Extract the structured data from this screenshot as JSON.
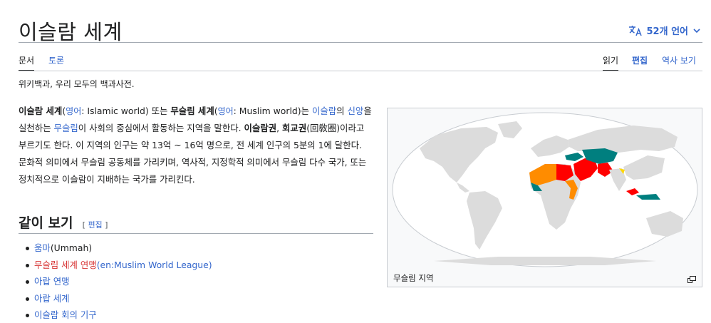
{
  "page": {
    "title": "이슬람 세계",
    "languages_label": "52개 언어"
  },
  "tabs": {
    "article": "문서",
    "talk": "토론",
    "read": "읽기",
    "edit": "편집",
    "history": "역사 보기"
  },
  "tagline": "위키백과, 우리 모두의 백과사전.",
  "intro": {
    "t1": "이슬람 세계",
    "t2": "(",
    "t3": "영어",
    "t4": ": Islamic world) 또는 ",
    "t5": "무슬림 세계",
    "t6": "(",
    "t7": "영어",
    "t8": ": Muslim world)는 ",
    "t9": "이슬람",
    "t10": "의 ",
    "t11": "신앙",
    "t12": "을 실천하는 ",
    "t13": "무슬림",
    "t14": "이 사회의 중심에서 활동하는 지역을 말한다. ",
    "t15": "이슬람권",
    "t16": ", ",
    "t17": "회교권",
    "t18": "(回敎圈)이라고 부르기도 한다. 이 지역의 인구는 약 13억 ~ 16억 명으로, 전 세계 인구의 5분의 1에 달한다. 문화적 의미에서 무슬림 공동체를 가리키며, 역사적, 지정학적 의미에서 무슬림 다수 국가, 또는 정치적으로 이슬람이 지배하는 국가를 가리킨다."
  },
  "see_also": {
    "heading": "같이 보기",
    "edit_label": "편집",
    "items": [
      {
        "text": "움마",
        "suffix": "(Ummah)"
      },
      {
        "text": "무슬림 세계 연맹",
        "suffix_link": "(en:Muslim World League)"
      },
      {
        "text": "아랍 연맹"
      },
      {
        "text": "아랍 세계"
      },
      {
        "text": "이슬람 회의 기구"
      }
    ]
  },
  "figure": {
    "caption": "무슬림 지역"
  },
  "colors": {
    "link": "#3366cc",
    "red_link": "#d73333",
    "map_land": "#dcdcdc",
    "map_red": "#ff0000",
    "map_orange": "#ff8c00",
    "map_teal": "#007f7f",
    "map_yellow": "#ffd700"
  }
}
